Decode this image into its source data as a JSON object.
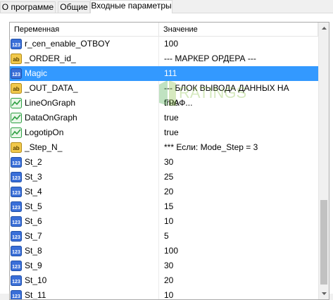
{
  "tabs": [
    {
      "label": "О программе"
    },
    {
      "label": "Общие"
    },
    {
      "label": "Входные параметры"
    }
  ],
  "table": {
    "columns": [
      "Переменная",
      "Значение"
    ],
    "rows": [
      {
        "icon": "numeric-icon",
        "name": "r_cen_enable_OTBOY",
        "value": "100"
      },
      {
        "icon": "text-icon",
        "name": "_ORDER_id_",
        "value": "--- МАРКЕР ОРДЕРА ---"
      },
      {
        "icon": "numeric-icon",
        "name": "Magic",
        "value": "111",
        "selected": true
      },
      {
        "icon": "text-icon",
        "name": "_OUT_DATA_",
        "value": "--- БЛОК ВЫВОДА ДАННЫХ НА ГРАФ..."
      },
      {
        "icon": "bool-icon",
        "name": "LineOnGraph",
        "value": "true"
      },
      {
        "icon": "bool-icon",
        "name": "DataOnGraph",
        "value": "true"
      },
      {
        "icon": "bool-icon",
        "name": "LogotipOn",
        "value": "true"
      },
      {
        "icon": "text-icon",
        "name": "_Step_N_",
        "value": "*** Если: Mode_Step = 3"
      },
      {
        "icon": "numeric-icon",
        "name": "St_2",
        "value": "30"
      },
      {
        "icon": "numeric-icon",
        "name": "St_3",
        "value": "25"
      },
      {
        "icon": "numeric-icon",
        "name": "St_4",
        "value": "20"
      },
      {
        "icon": "numeric-icon",
        "name": "St_5",
        "value": "15"
      },
      {
        "icon": "numeric-icon",
        "name": "St_6",
        "value": "10"
      },
      {
        "icon": "numeric-icon",
        "name": "St_7",
        "value": "5"
      },
      {
        "icon": "numeric-icon",
        "name": "St_8",
        "value": "100"
      },
      {
        "icon": "numeric-icon",
        "name": "St_9",
        "value": "30"
      },
      {
        "icon": "numeric-icon",
        "name": "St_10",
        "value": "20"
      },
      {
        "icon": "numeric-icon",
        "name": "St_11",
        "value": "10"
      }
    ]
  },
  "watermark": {
    "text": "RATINGS"
  },
  "colors": {
    "selection": "#3399ff",
    "numeric_icon": "#3a6fd8",
    "text_icon": "#d4a017",
    "bool_icon": "#2ea043"
  }
}
